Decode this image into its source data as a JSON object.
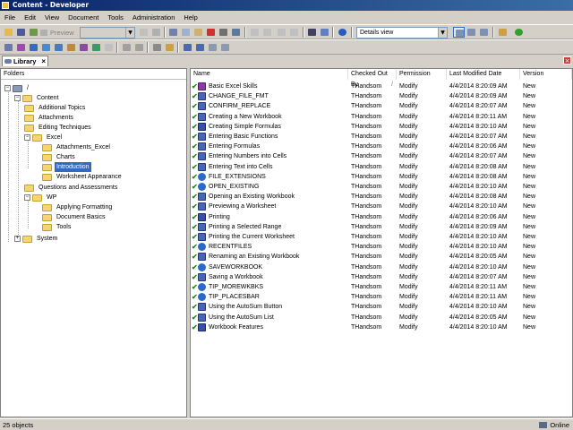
{
  "window": {
    "title": "Content - Developer"
  },
  "menu": [
    "File",
    "Edit",
    "View",
    "Document",
    "Tools",
    "Administration",
    "Help"
  ],
  "toolbar": {
    "preview_label": "Preview",
    "view_select": "Details view"
  },
  "tab": {
    "label": "Library",
    "close": "×"
  },
  "folders": {
    "header": "Folders",
    "tree": [
      {
        "label": "/",
        "level": 0,
        "expanded": true
      },
      {
        "label": "Content",
        "level": 1,
        "expanded": true
      },
      {
        "label": "Additional Topics",
        "level": 2
      },
      {
        "label": "Attachments",
        "level": 2
      },
      {
        "label": "Editing Techniques",
        "level": 2
      },
      {
        "label": "Excel",
        "level": 2,
        "expanded": true
      },
      {
        "label": "Attachments_Excel",
        "level": 3
      },
      {
        "label": "Charts",
        "level": 3
      },
      {
        "label": "Introduction",
        "level": 3,
        "selected": true
      },
      {
        "label": "Worksheet Appearance",
        "level": 3
      },
      {
        "label": "Questions and Assessments",
        "level": 2
      },
      {
        "label": "WP",
        "level": 2,
        "expanded": true
      },
      {
        "label": "Applying Formatting",
        "level": 3
      },
      {
        "label": "Document Basics",
        "level": 3
      },
      {
        "label": "Tools",
        "level": 3
      },
      {
        "label": "System",
        "level": 1,
        "collapsed": true
      }
    ]
  },
  "files": {
    "columns": [
      "Name",
      "Checked Out By",
      "Permission",
      "Last Modified Date",
      "Version"
    ],
    "rows": [
      {
        "name": "Basic Excel Skills",
        "icon": "sim",
        "checked_out_by": "THandsom",
        "permission": "Modify",
        "modified": "4/4/2014 8:20:09 AM",
        "version": "New"
      },
      {
        "name": "CHANGE_FILE_FMT",
        "icon": "doc",
        "checked_out_by": "THandsom",
        "permission": "Modify",
        "modified": "4/4/2014 8:20:09 AM",
        "version": "New"
      },
      {
        "name": "CONFIRM_REPLACE",
        "icon": "doc",
        "checked_out_by": "THandsom",
        "permission": "Modify",
        "modified": "4/4/2014 8:20:07 AM",
        "version": "New"
      },
      {
        "name": "Creating a New Workbook",
        "icon": "doc",
        "checked_out_by": "THandsom",
        "permission": "Modify",
        "modified": "4/4/2014 8:20:11 AM",
        "version": "New"
      },
      {
        "name": "Creating Simple Formulas",
        "icon": "book",
        "checked_out_by": "THandsom",
        "permission": "Modify",
        "modified": "4/4/2014 8:20:10 AM",
        "version": "New"
      },
      {
        "name": "Entering Basic Functions",
        "icon": "doc",
        "checked_out_by": "THandsom",
        "permission": "Modify",
        "modified": "4/4/2014 8:20:07 AM",
        "version": "New"
      },
      {
        "name": "Entering Formulas",
        "icon": "doc",
        "checked_out_by": "THandsom",
        "permission": "Modify",
        "modified": "4/4/2014 8:20:06 AM",
        "version": "New"
      },
      {
        "name": "Entering Numbers into Cells",
        "icon": "doc",
        "checked_out_by": "THandsom",
        "permission": "Modify",
        "modified": "4/4/2014 8:20:07 AM",
        "version": "New"
      },
      {
        "name": "Entering Text into Cells",
        "icon": "doc",
        "checked_out_by": "THandsom",
        "permission": "Modify",
        "modified": "4/4/2014 8:20:08 AM",
        "version": "New"
      },
      {
        "name": "FILE_EXTENSIONS",
        "icon": "blue",
        "checked_out_by": "THandsom",
        "permission": "Modify",
        "modified": "4/4/2014 8:20:08 AM",
        "version": "New"
      },
      {
        "name": "OPEN_EXISTING",
        "icon": "blue",
        "checked_out_by": "THandsom",
        "permission": "Modify",
        "modified": "4/4/2014 8:20:10 AM",
        "version": "New"
      },
      {
        "name": "Opening an Existing Workbook",
        "icon": "doc",
        "checked_out_by": "THandsom",
        "permission": "Modify",
        "modified": "4/4/2014 8:20:08 AM",
        "version": "New"
      },
      {
        "name": "Previewing a Worksheet",
        "icon": "doc",
        "checked_out_by": "THandsom",
        "permission": "Modify",
        "modified": "4/4/2014 8:20:10 AM",
        "version": "New"
      },
      {
        "name": "Printing",
        "icon": "book",
        "checked_out_by": "THandsom",
        "permission": "Modify",
        "modified": "4/4/2014 8:20:06 AM",
        "version": "New"
      },
      {
        "name": "Printing a Selected Range",
        "icon": "doc",
        "checked_out_by": "THandsom",
        "permission": "Modify",
        "modified": "4/4/2014 8:20:09 AM",
        "version": "New"
      },
      {
        "name": "Printing the Current Worksheet",
        "icon": "doc",
        "checked_out_by": "THandsom",
        "permission": "Modify",
        "modified": "4/4/2014 8:20:10 AM",
        "version": "New"
      },
      {
        "name": "RECENTFILES",
        "icon": "blue",
        "checked_out_by": "THandsom",
        "permission": "Modify",
        "modified": "4/4/2014 8:20:10 AM",
        "version": "New"
      },
      {
        "name": "Renaming an Existing Workbook",
        "icon": "doc",
        "checked_out_by": "THandsom",
        "permission": "Modify",
        "modified": "4/4/2014 8:20:05 AM",
        "version": "New"
      },
      {
        "name": "SAVEWORKBOOK",
        "icon": "blue",
        "checked_out_by": "THandsom",
        "permission": "Modify",
        "modified": "4/4/2014 8:20:10 AM",
        "version": "New"
      },
      {
        "name": "Saving a Workbook",
        "icon": "doc",
        "checked_out_by": "THandsom",
        "permission": "Modify",
        "modified": "4/4/2014 8:20:07 AM",
        "version": "New"
      },
      {
        "name": "TIP_MOREWKBKS",
        "icon": "blue",
        "checked_out_by": "THandsom",
        "permission": "Modify",
        "modified": "4/4/2014 8:20:11 AM",
        "version": "New"
      },
      {
        "name": "TIP_PLACESBAR",
        "icon": "blue",
        "checked_out_by": "THandsom",
        "permission": "Modify",
        "modified": "4/4/2014 8:20:11 AM",
        "version": "New"
      },
      {
        "name": "Using the AutoSum Button",
        "icon": "doc",
        "checked_out_by": "THandsom",
        "permission": "Modify",
        "modified": "4/4/2014 8:20:10 AM",
        "version": "New"
      },
      {
        "name": "Using the AutoSum List",
        "icon": "doc",
        "checked_out_by": "THandsom",
        "permission": "Modify",
        "modified": "4/4/2014 8:20:05 AM",
        "version": "New"
      },
      {
        "name": "Workbook Features",
        "icon": "book",
        "checked_out_by": "THandsom",
        "permission": "Modify",
        "modified": "4/4/2014 8:20:10 AM",
        "version": "New"
      }
    ]
  },
  "status": {
    "count": "25 objects",
    "connection": "Online"
  }
}
